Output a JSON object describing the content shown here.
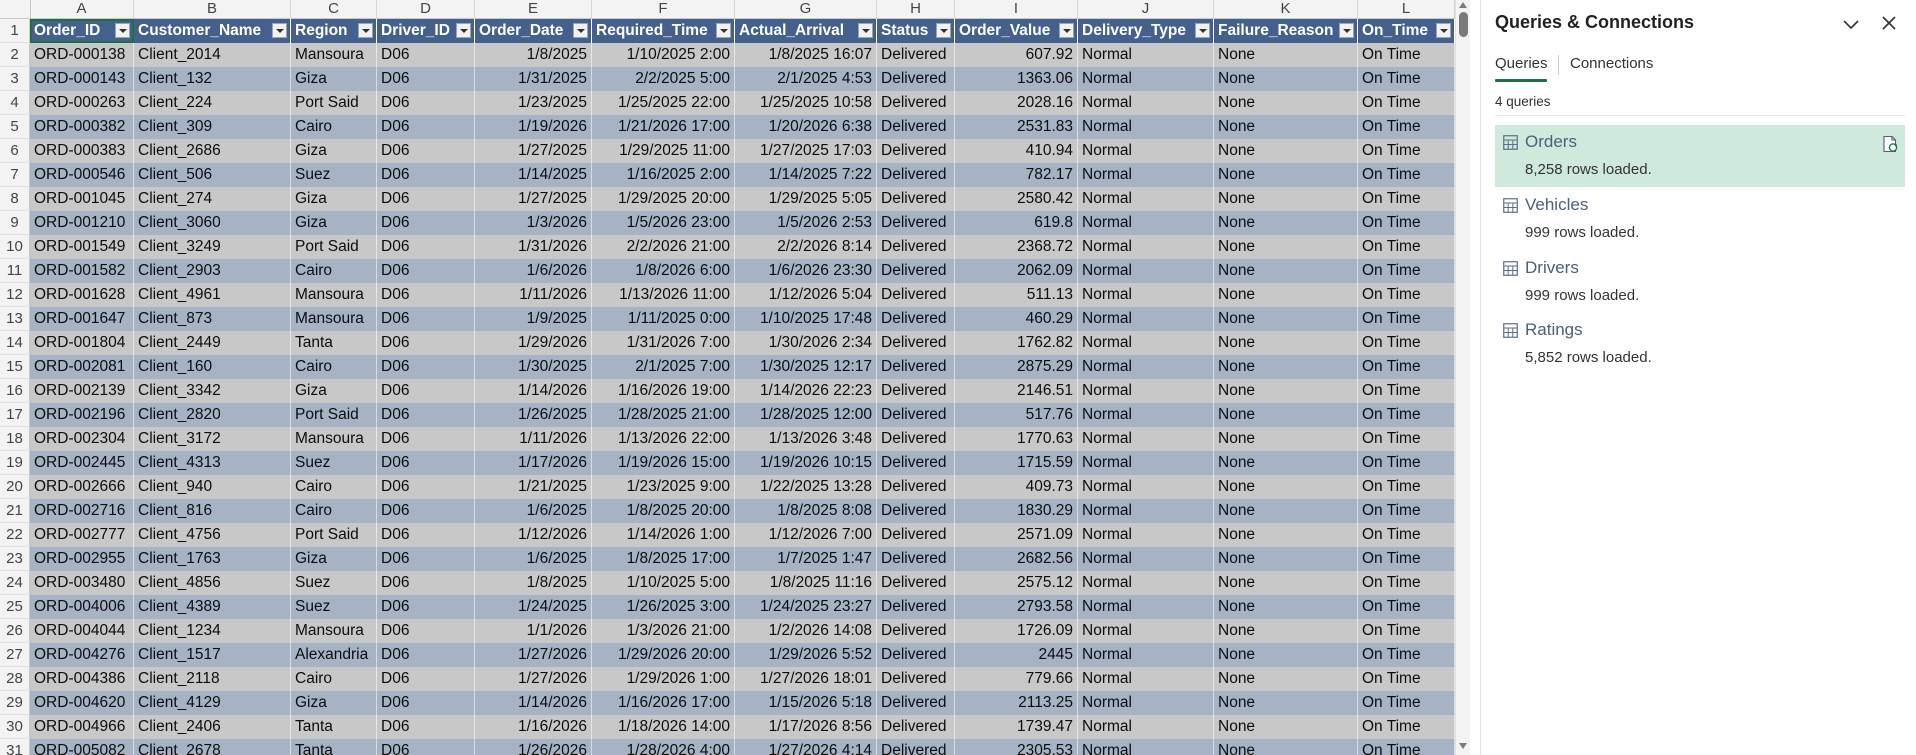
{
  "sheet": {
    "columns": [
      "A",
      "B",
      "C",
      "D",
      "E",
      "F",
      "G",
      "H",
      "I",
      "J",
      "K",
      "L"
    ],
    "headers": [
      "Order_ID",
      "Customer_Name",
      "Region",
      "Driver_ID",
      "Order_Date",
      "Required_Time",
      "Actual_Arrival",
      "Status",
      "Order_Value",
      "Delivery_Type",
      "Failure_Reason",
      "On_Time"
    ],
    "row_numbers": [
      "1",
      "2",
      "3",
      "4",
      "5",
      "6",
      "7",
      "8",
      "9",
      "10",
      "11",
      "12",
      "13",
      "14",
      "15",
      "16",
      "17",
      "18",
      "19",
      "20",
      "21",
      "22",
      "23",
      "24",
      "25",
      "26",
      "27",
      "28",
      "29",
      "30",
      "31"
    ],
    "rows": [
      [
        "ORD-000138",
        "Client_2014",
        "Mansoura",
        "D06",
        "1/8/2025",
        "1/10/2025 2:00",
        "1/8/2025 16:07",
        "Delivered",
        "607.92",
        "Normal",
        "None",
        "On Time"
      ],
      [
        "ORD-000143",
        "Client_132",
        "Giza",
        "D06",
        "1/31/2025",
        "2/2/2025 5:00",
        "2/1/2025 4:53",
        "Delivered",
        "1363.06",
        "Normal",
        "None",
        "On Time"
      ],
      [
        "ORD-000263",
        "Client_224",
        "Port Said",
        "D06",
        "1/23/2025",
        "1/25/2025 22:00",
        "1/25/2025 10:58",
        "Delivered",
        "2028.16",
        "Normal",
        "None",
        "On Time"
      ],
      [
        "ORD-000382",
        "Client_309",
        "Cairo",
        "D06",
        "1/19/2026",
        "1/21/2026 17:00",
        "1/20/2026 6:38",
        "Delivered",
        "2531.83",
        "Normal",
        "None",
        "On Time"
      ],
      [
        "ORD-000383",
        "Client_2686",
        "Giza",
        "D06",
        "1/27/2025",
        "1/29/2025 11:00",
        "1/27/2025 17:03",
        "Delivered",
        "410.94",
        "Normal",
        "None",
        "On Time"
      ],
      [
        "ORD-000546",
        "Client_506",
        "Suez",
        "D06",
        "1/14/2025",
        "1/16/2025 2:00",
        "1/14/2025 7:22",
        "Delivered",
        "782.17",
        "Normal",
        "None",
        "On Time"
      ],
      [
        "ORD-001045",
        "Client_274",
        "Giza",
        "D06",
        "1/27/2025",
        "1/29/2025 20:00",
        "1/29/2025 5:05",
        "Delivered",
        "2580.42",
        "Normal",
        "None",
        "On Time"
      ],
      [
        "ORD-001210",
        "Client_3060",
        "Giza",
        "D06",
        "1/3/2026",
        "1/5/2026 23:00",
        "1/5/2026 2:53",
        "Delivered",
        "619.8",
        "Normal",
        "None",
        "On Time"
      ],
      [
        "ORD-001549",
        "Client_3249",
        "Port Said",
        "D06",
        "1/31/2026",
        "2/2/2026 21:00",
        "2/2/2026 8:14",
        "Delivered",
        "2368.72",
        "Normal",
        "None",
        "On Time"
      ],
      [
        "ORD-001582",
        "Client_2903",
        "Cairo",
        "D06",
        "1/6/2026",
        "1/8/2026 6:00",
        "1/6/2026 23:30",
        "Delivered",
        "2062.09",
        "Normal",
        "None",
        "On Time"
      ],
      [
        "ORD-001628",
        "Client_4961",
        "Mansoura",
        "D06",
        "1/11/2026",
        "1/13/2026 11:00",
        "1/12/2026 5:04",
        "Delivered",
        "511.13",
        "Normal",
        "None",
        "On Time"
      ],
      [
        "ORD-001647",
        "Client_873",
        "Mansoura",
        "D06",
        "1/9/2025",
        "1/11/2025 0:00",
        "1/10/2025 17:48",
        "Delivered",
        "460.29",
        "Normal",
        "None",
        "On Time"
      ],
      [
        "ORD-001804",
        "Client_2449",
        "Tanta",
        "D06",
        "1/29/2026",
        "1/31/2026 7:00",
        "1/30/2026 2:34",
        "Delivered",
        "1762.82",
        "Normal",
        "None",
        "On Time"
      ],
      [
        "ORD-002081",
        "Client_160",
        "Cairo",
        "D06",
        "1/30/2025",
        "2/1/2025 7:00",
        "1/30/2025 12:17",
        "Delivered",
        "2875.29",
        "Normal",
        "None",
        "On Time"
      ],
      [
        "ORD-002139",
        "Client_3342",
        "Giza",
        "D06",
        "1/14/2026",
        "1/16/2026 19:00",
        "1/14/2026 22:23",
        "Delivered",
        "2146.51",
        "Normal",
        "None",
        "On Time"
      ],
      [
        "ORD-002196",
        "Client_2820",
        "Port Said",
        "D06",
        "1/26/2025",
        "1/28/2025 21:00",
        "1/28/2025 12:00",
        "Delivered",
        "517.76",
        "Normal",
        "None",
        "On Time"
      ],
      [
        "ORD-002304",
        "Client_3172",
        "Mansoura",
        "D06",
        "1/11/2026",
        "1/13/2026 22:00",
        "1/13/2026 3:48",
        "Delivered",
        "1770.63",
        "Normal",
        "None",
        "On Time"
      ],
      [
        "ORD-002445",
        "Client_4313",
        "Suez",
        "D06",
        "1/17/2026",
        "1/19/2026 15:00",
        "1/19/2026 10:15",
        "Delivered",
        "1715.59",
        "Normal",
        "None",
        "On Time"
      ],
      [
        "ORD-002666",
        "Client_940",
        "Cairo",
        "D06",
        "1/21/2025",
        "1/23/2025 9:00",
        "1/22/2025 13:28",
        "Delivered",
        "409.73",
        "Normal",
        "None",
        "On Time"
      ],
      [
        "ORD-002716",
        "Client_816",
        "Cairo",
        "D06",
        "1/6/2025",
        "1/8/2025 20:00",
        "1/8/2025 8:08",
        "Delivered",
        "1830.29",
        "Normal",
        "None",
        "On Time"
      ],
      [
        "ORD-002777",
        "Client_4756",
        "Port Said",
        "D06",
        "1/12/2026",
        "1/14/2026 1:00",
        "1/12/2026 7:00",
        "Delivered",
        "2571.09",
        "Normal",
        "None",
        "On Time"
      ],
      [
        "ORD-002955",
        "Client_1763",
        "Giza",
        "D06",
        "1/6/2025",
        "1/8/2025 17:00",
        "1/7/2025 1:47",
        "Delivered",
        "2682.56",
        "Normal",
        "None",
        "On Time"
      ],
      [
        "ORD-003480",
        "Client_4856",
        "Suez",
        "D06",
        "1/8/2025",
        "1/10/2025 5:00",
        "1/8/2025 11:16",
        "Delivered",
        "2575.12",
        "Normal",
        "None",
        "On Time"
      ],
      [
        "ORD-004006",
        "Client_4389",
        "Suez",
        "D06",
        "1/24/2025",
        "1/26/2025 3:00",
        "1/24/2025 23:27",
        "Delivered",
        "2793.58",
        "Normal",
        "None",
        "On Time"
      ],
      [
        "ORD-004044",
        "Client_1234",
        "Mansoura",
        "D06",
        "1/1/2026",
        "1/3/2026 21:00",
        "1/2/2026 14:08",
        "Delivered",
        "1726.09",
        "Normal",
        "None",
        "On Time"
      ],
      [
        "ORD-004276",
        "Client_1517",
        "Alexandria",
        "D06",
        "1/27/2026",
        "1/29/2026 20:00",
        "1/29/2026 5:52",
        "Delivered",
        "2445",
        "Normal",
        "None",
        "On Time"
      ],
      [
        "ORD-004386",
        "Client_2118",
        "Cairo",
        "D06",
        "1/27/2026",
        "1/29/2026 1:00",
        "1/27/2026 18:01",
        "Delivered",
        "779.66",
        "Normal",
        "None",
        "On Time"
      ],
      [
        "ORD-004620",
        "Client_4129",
        "Giza",
        "D06",
        "1/14/2026",
        "1/16/2026 17:00",
        "1/15/2026 5:18",
        "Delivered",
        "2113.25",
        "Normal",
        "None",
        "On Time"
      ],
      [
        "ORD-004966",
        "Client_2406",
        "Tanta",
        "D06",
        "1/16/2026",
        "1/18/2026 14:00",
        "1/17/2026 8:56",
        "Delivered",
        "1739.47",
        "Normal",
        "None",
        "On Time"
      ],
      [
        "ORD-005082",
        "Client_2678",
        "Tanta",
        "D06",
        "1/26/2026",
        "1/28/2026 4:00",
        "1/27/2026 4:14",
        "Delivered",
        "2305.53",
        "Normal",
        "None",
        "On Time"
      ]
    ],
    "colors": {
      "header": "#44618d",
      "band_light": "#c8c8c8",
      "band_dark": "#a6b3c5",
      "selection": "#1e7145"
    }
  },
  "pane": {
    "title": "Queries & Connections",
    "tabs": [
      "Queries",
      "Connections"
    ],
    "count": "4 queries",
    "queries": [
      {
        "name": "Orders",
        "rows": "8,258 rows loaded.",
        "selected": true
      },
      {
        "name": "Vehicles",
        "rows": "999 rows loaded.",
        "selected": false
      },
      {
        "name": "Drivers",
        "rows": "999 rows loaded.",
        "selected": false
      },
      {
        "name": "Ratings",
        "rows": "5,852 rows loaded.",
        "selected": false
      }
    ],
    "icons": [
      "chevron-down-icon",
      "close-icon",
      "table-icon",
      "refresh-icon"
    ],
    "colors": {
      "selected_bg": "#cfe9dc",
      "tab_underline": "#1e7145"
    }
  }
}
